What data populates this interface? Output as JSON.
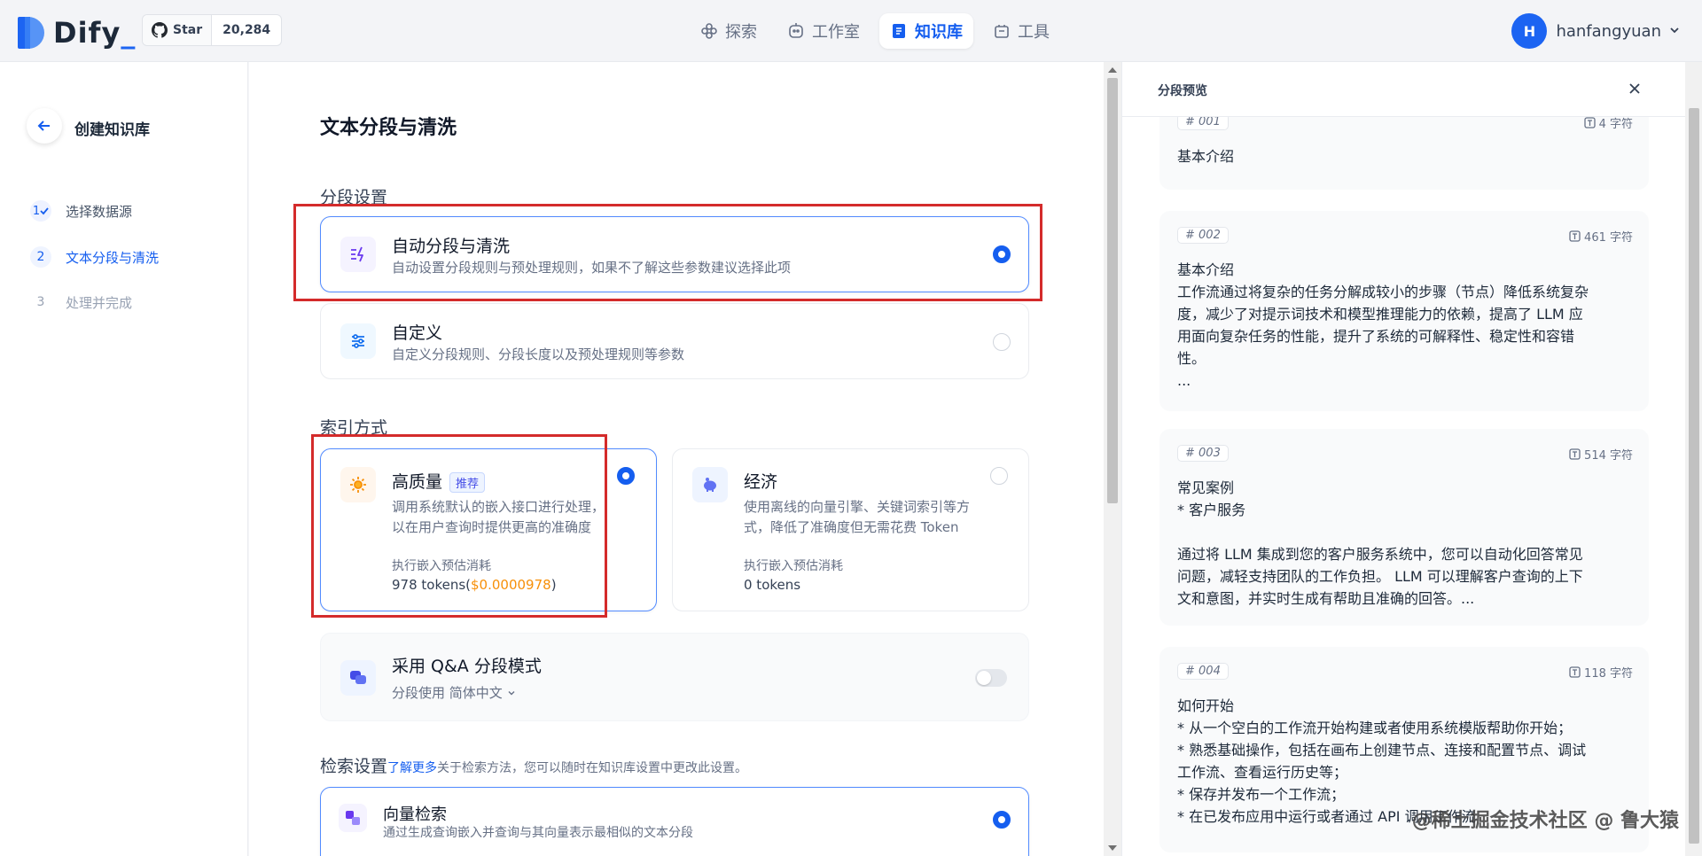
{
  "header": {
    "logo_text": "Dify",
    "github": {
      "label": "Star",
      "count": "20,284"
    },
    "nav": [
      {
        "label": "探索",
        "icon": "explore-icon"
      },
      {
        "label": "工作室",
        "icon": "studio-icon"
      },
      {
        "label": "知识库",
        "icon": "knowledge-icon",
        "active": true
      },
      {
        "label": "工具",
        "icon": "tools-icon"
      }
    ],
    "user": {
      "initial": "H",
      "name": "hanfangyuan"
    }
  },
  "sidebar": {
    "title": "创建知识库",
    "steps": [
      {
        "num": "1",
        "label": "选择数据源",
        "state": "done"
      },
      {
        "num": "2",
        "label": "文本分段与清洗",
        "state": "active"
      },
      {
        "num": "3",
        "label": "处理并完成",
        "state": "pending"
      }
    ]
  },
  "main": {
    "title": "文本分段与清洗",
    "segment_section": "分段设置",
    "auto": {
      "title": "自动分段与清洗",
      "desc": "自动设置分段规则与预处理规则，如果不了解这些参数建议选择此项",
      "selected": true
    },
    "custom": {
      "title": "自定义",
      "desc": "自定义分段规则、分段长度以及预处理规则等参数",
      "selected": false
    },
    "index_section": "索引方式",
    "high_quality": {
      "title": "高质量",
      "badge": "推荐",
      "desc_line1": "调用系统默认的嵌入接口进行处理，",
      "desc_line2": "以在用户查询时提供更高的准确度",
      "cost_label": "执行嵌入预估消耗",
      "cost_tokens": "978 tokens(",
      "cost_money": "$0.0000978",
      "cost_close": ")",
      "selected": true
    },
    "economy": {
      "title": "经济",
      "desc_line1": "使用离线的向量引擎、关键词索引等方",
      "desc_line2": "式，降低了准确度但无需花费 Token",
      "cost_label": "执行嵌入预估消耗",
      "cost_tokens": "0 tokens",
      "selected": false
    },
    "qa": {
      "title": "采用 Q&A 分段模式",
      "lang_label": "分段使用",
      "lang": "简体中文",
      "enabled": false
    },
    "retrieval": {
      "title": "检索设置",
      "link": "了解更多",
      "desc": "关于检索方法，您可以随时在知识库设置中更改此设置。"
    },
    "vector": {
      "title": "向量检索",
      "desc": "通过生成查询嵌入并查询与其向量表示最相似的文本分段",
      "selected": true
    }
  },
  "preview": {
    "title": "分段预览",
    "segments": [
      {
        "id": "# 001",
        "count": "4 字符",
        "text": "基本介绍"
      },
      {
        "id": "# 002",
        "count": "461 字符",
        "text": "基本介绍\n工作流通过将复杂的任务分解成较小的步骤（节点）降低系统复杂\n度，减少了对提示词技术和模型推理能力的依赖，提高了 LLM 应\n用面向复杂任务的性能，提升了系统的可解释性、稳定性和容错\n性。\n..."
      },
      {
        "id": "# 003",
        "count": "514 字符",
        "text": "常见案例\n* 客户服务\n\n通过将 LLM 集成到您的客户服务系统中，您可以自动化回答常见\n问题，减轻支持团队的工作负担。 LLM 可以理解客户查询的上下\n文和意图，并实时生成有帮助且准确的回答。..."
      },
      {
        "id": "# 004",
        "count": "118 字符",
        "text": "如何开始\n* 从一个空白的工作流开始构建或者使用系统模版帮助你开始；\n* 熟悉基础操作，包括在画布上创建节点、连接和配置节点、调试\n工作流、查看运行历史等；\n* 保存并发布一个工作流；\n* 在已发布应用中运行或者通过 API 调用工作流"
      }
    ]
  },
  "watermark": "@稀土掘金技术社区 @ 鲁大猿",
  "colors": {
    "accent": "#155eef",
    "highlight_border": "#d42b2b",
    "money": "#f79009"
  }
}
